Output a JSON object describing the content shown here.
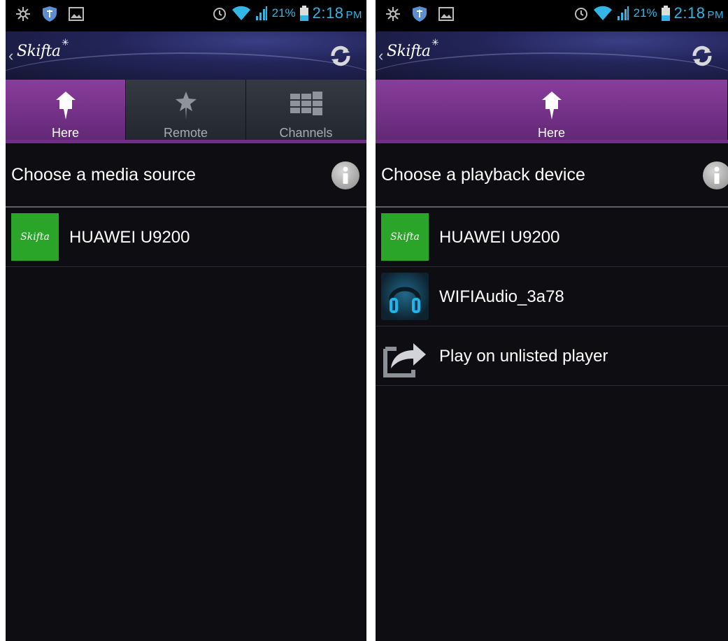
{
  "status_bar": {
    "battery_percent": "21%",
    "time": "2:18",
    "ampm": "PM",
    "icons": [
      "brightness-icon",
      "shield-icon",
      "gallery-icon",
      "alarm-icon",
      "wifi-icon",
      "signal-icon",
      "battery-icon"
    ]
  },
  "app": {
    "logo_text": "Skifta"
  },
  "colors": {
    "accent": "#33b5e5",
    "tab_active": "#7a3590",
    "skifta_green": "#2aa52a"
  },
  "left_screen": {
    "tabs": [
      {
        "label": "Here",
        "icon": "house-icon",
        "active": true
      },
      {
        "label": "Remote",
        "icon": "star-icon",
        "active": false
      },
      {
        "label": "Channels",
        "icon": "grid-icon",
        "active": false
      }
    ],
    "section_title": "Choose a media source",
    "items": [
      {
        "label": "HUAWEI U9200",
        "icon": "skifta-icon"
      }
    ]
  },
  "right_screen": {
    "tabs": [
      {
        "label": "Here",
        "icon": "house-icon",
        "active": true
      }
    ],
    "section_title": "Choose a playback device",
    "items": [
      {
        "label": "HUAWEI U9200",
        "icon": "skifta-icon"
      },
      {
        "label": "WIFIAudio_3a78",
        "icon": "headphones-icon"
      },
      {
        "label": "Play on unlisted player",
        "icon": "share-icon"
      }
    ]
  }
}
